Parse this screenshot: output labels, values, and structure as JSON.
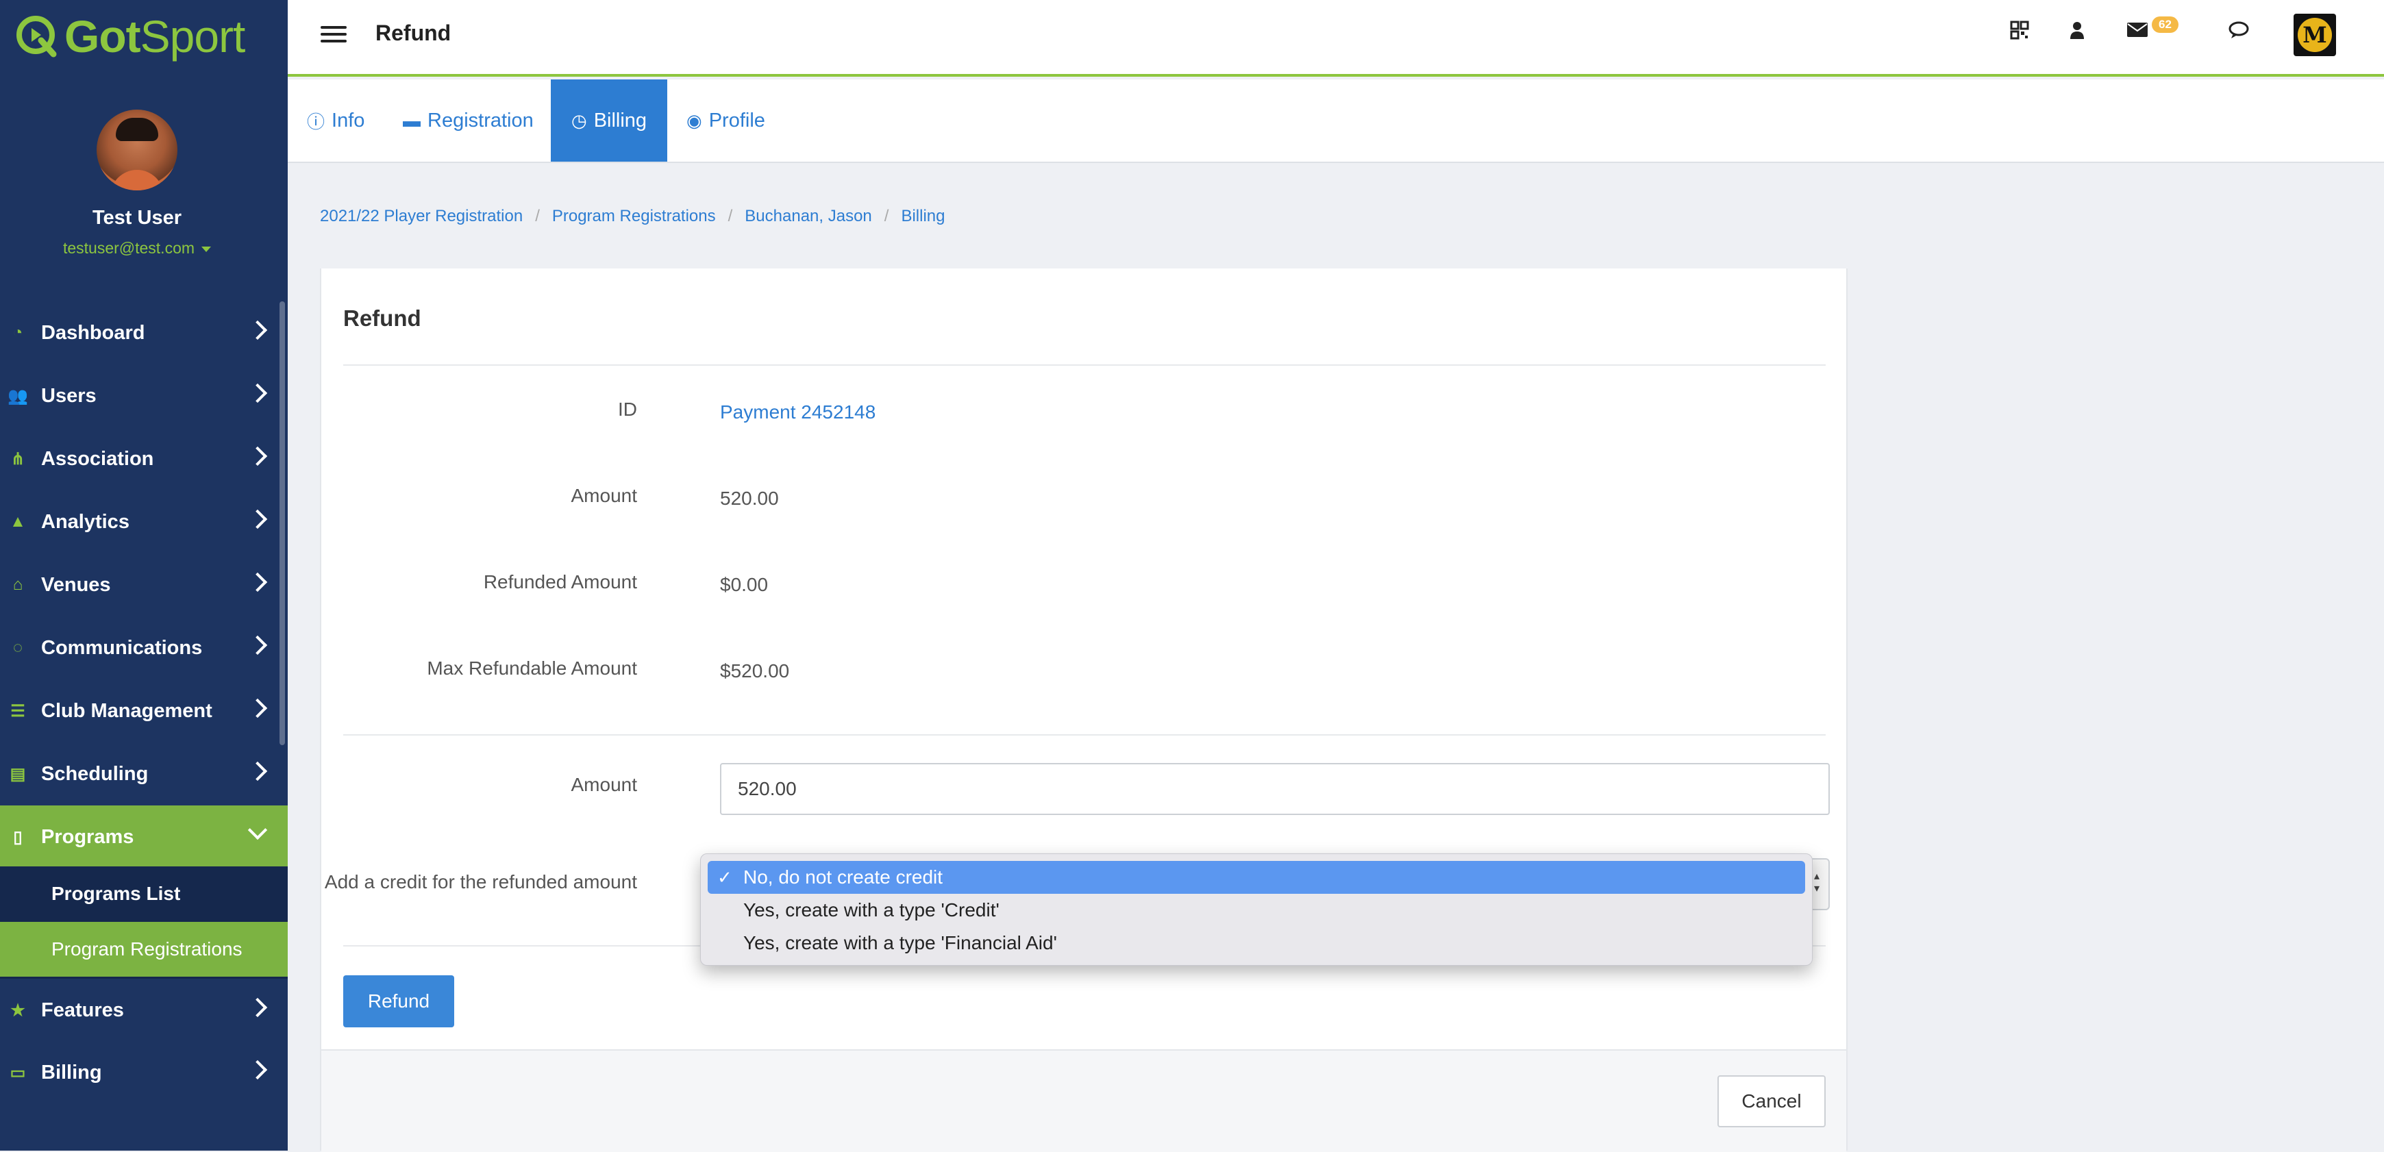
{
  "brand": {
    "logo_text_main": "Got",
    "logo_text_end": "Sport"
  },
  "user": {
    "name": "Test User",
    "email": "testuser@test.com"
  },
  "sidebar": {
    "items": [
      {
        "label": "Dashboard",
        "icon": "dashboard-icon"
      },
      {
        "label": "Users",
        "icon": "users-icon"
      },
      {
        "label": "Association",
        "icon": "sitemap-icon"
      },
      {
        "label": "Analytics",
        "icon": "area-chart-icon"
      },
      {
        "label": "Venues",
        "icon": "home-icon"
      },
      {
        "label": "Communications",
        "icon": "chat-icon"
      },
      {
        "label": "Club Management",
        "icon": "list-icon"
      },
      {
        "label": "Scheduling",
        "icon": "calendar-list-icon"
      },
      {
        "label": "Programs",
        "icon": "document-icon"
      },
      {
        "label": "Features",
        "icon": "star-icon"
      },
      {
        "label": "Billing",
        "icon": "credit-card-icon"
      }
    ],
    "programs_sub": [
      "Programs List",
      "Program Registrations"
    ]
  },
  "topbar": {
    "title": "Refund",
    "mail_count": "62"
  },
  "tabs": [
    {
      "label": "Info",
      "icon": "info-icon"
    },
    {
      "label": "Registration",
      "icon": "archive-icon"
    },
    {
      "label": "Billing",
      "icon": "clock-icon"
    },
    {
      "label": "Profile",
      "icon": "user-circle-icon"
    }
  ],
  "breadcrumb": [
    "2021/22 Player Registration",
    "Program Registrations",
    "Buchanan, Jason",
    "Billing"
  ],
  "form": {
    "title": "Refund",
    "id_label": "ID",
    "id_value": "Payment 2452148",
    "amount_label": "Amount",
    "amount_value": "520.00",
    "refunded_label": "Refunded Amount",
    "refunded_value": "$0.00",
    "max_label": "Max Refundable Amount",
    "max_value": "$520.00",
    "input_amount_label": "Amount",
    "input_amount_value": "520.00",
    "credit_label": "Add a credit for the refunded amount",
    "credit_options": [
      "No, do not create credit",
      "Yes, create with a type 'Credit'",
      "Yes, create with a type 'Financial Aid'"
    ],
    "credit_selected": 0,
    "refund_button": "Refund",
    "cancel_button": "Cancel"
  },
  "colors": {
    "sidebar": "#1d3461",
    "accent_green": "#7cb342",
    "link_blue": "#2d7dd2",
    "select_highlight": "#5b97f0"
  }
}
